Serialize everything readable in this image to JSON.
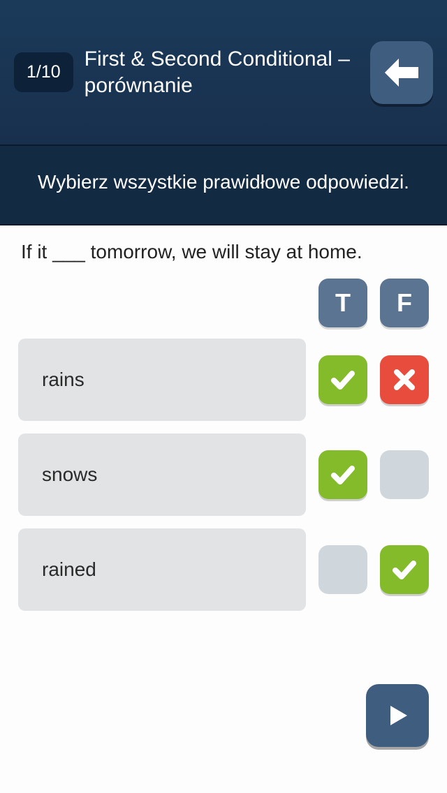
{
  "header": {
    "counter": "1/10",
    "title": "First & Second Conditional – porównanie"
  },
  "instruction": "Wybierz wszystkie prawidłowe odpowiedzi.",
  "question": "If it ___ tomorrow, we will stay at home.",
  "tf_labels": {
    "true": "T",
    "false": "F"
  },
  "options": [
    {
      "text": "rains",
      "t_state": "green",
      "f_state": "red"
    },
    {
      "text": "snows",
      "t_state": "green",
      "f_state": "empty"
    },
    {
      "text": "rained",
      "t_state": "empty",
      "f_state": "green"
    }
  ]
}
